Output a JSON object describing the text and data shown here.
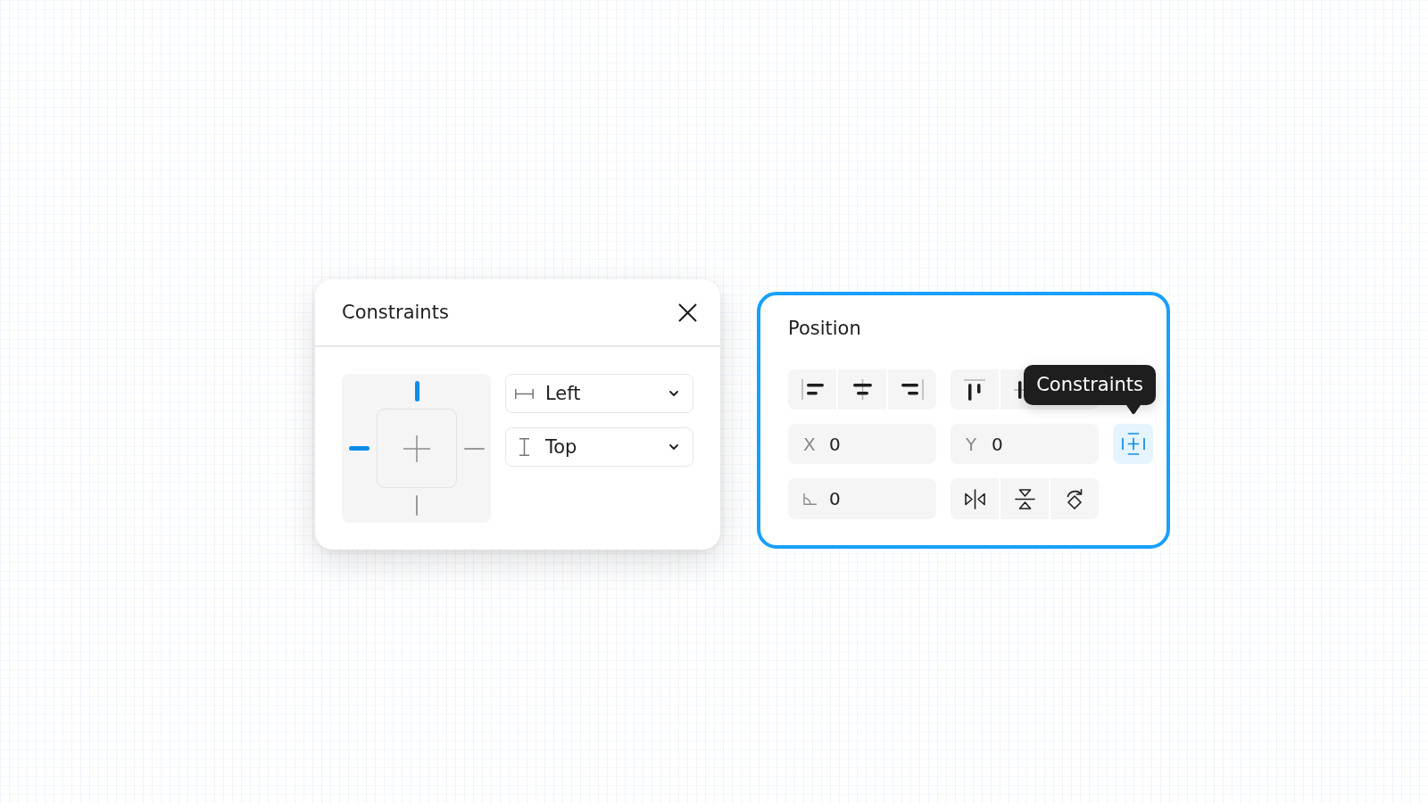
{
  "constraints_panel": {
    "title": "Constraints",
    "diagram": {
      "edges": [
        {
          "kind": "top",
          "on": true
        },
        {
          "kind": "left",
          "on": true
        },
        {
          "kind": "right",
          "on": false
        },
        {
          "kind": "bottom",
          "on": false
        }
      ]
    },
    "dropdowns": [
      {
        "kind": "horizontal",
        "value": "Left"
      },
      {
        "kind": "vertical",
        "value": "Top"
      }
    ]
  },
  "position_panel": {
    "title": "Position",
    "highlighted": true,
    "align_groups": [
      {
        "buttons": [
          {
            "kind": "align-left"
          },
          {
            "kind": "align-center"
          },
          {
            "kind": "align-right"
          }
        ]
      },
      {
        "buttons": [
          {
            "kind": "align-top"
          },
          {
            "kind": "align-middle"
          }
        ]
      }
    ],
    "fields": [
      {
        "kind": "label",
        "label": "X",
        "value": "0"
      },
      {
        "kind": "label",
        "label": "Y",
        "value": "0"
      },
      {
        "kind": "angle",
        "value": "0"
      }
    ],
    "constraints_toggle": {
      "on": true,
      "tooltip": "Constraints"
    },
    "transform_buttons": [
      {
        "kind": "flip-horizontal"
      },
      {
        "kind": "flip-vertical"
      },
      {
        "kind": "rotate"
      }
    ]
  }
}
